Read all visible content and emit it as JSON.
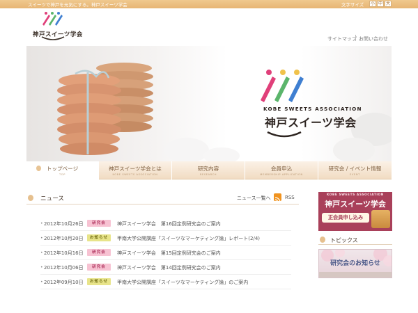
{
  "topbar": {
    "tagline": "スイーツで神戸を元気にする。神戸スイーツ学会",
    "font_size_label": "文字サイズ",
    "font_sizes": [
      "小",
      "中",
      "大"
    ]
  },
  "header": {
    "logo_text": "神戸スイーツ学会",
    "utility_links": [
      "サイトマップ",
      "お問い合わせ"
    ]
  },
  "hero": {
    "title_en": "KOBE SWEETS ASSOCIATION",
    "title_jp": "神戸スイーツ学会"
  },
  "nav": {
    "items": [
      {
        "label": "トップページ",
        "sub": "TOP"
      },
      {
        "label": "神戸スイーツ学会とは",
        "sub": "KOBE SWEETS ASSOCIATION"
      },
      {
        "label": "研究内容",
        "sub": "RESEARCH"
      },
      {
        "label": "会員申込",
        "sub": "MEMBERSHIP APPLICATION"
      },
      {
        "label": "研究会 / イベント情報",
        "sub": "EVENT"
      }
    ]
  },
  "news": {
    "title": "ニュース",
    "more_label": "ニュース一覧へ",
    "rss_label": "RSS",
    "items": [
      {
        "date": "2012年10月26日",
        "badge": "研究会",
        "badge_type": "study",
        "text": "神戸スイーツ学会　第16回定例研究会のご案内"
      },
      {
        "date": "2012年10月20日",
        "badge": "お知らせ",
        "badge_type": "notice",
        "text": "甲南大学公開講座「スイーツなマーケティング論」レポート(2/4)"
      },
      {
        "date": "2012年10月16日",
        "badge": "研究会",
        "badge_type": "study",
        "text": "神戸スイーツ学会　第15回定例研究会のご案内"
      },
      {
        "date": "2012年10月06日",
        "badge": "研究会",
        "badge_type": "study",
        "text": "神戸スイーツ学会　第14回定例研究会のご案内"
      },
      {
        "date": "2012年09月10日",
        "badge": "お知らせ",
        "badge_type": "notice",
        "text": "甲南大学公開講座「スイーツなマーケティング論」のご案内"
      }
    ]
  },
  "sidebar": {
    "banner": {
      "title_en": "KOBE SWEETS ASSOCIATION",
      "title_jp": "神戸スイーツ学会",
      "button": "正会員申し込み"
    },
    "topics": {
      "title": "トピックス",
      "banner_text": "研究会のお知らせ"
    }
  },
  "colors": {
    "accent": "#e7b574",
    "pink": "#e0407a",
    "green": "#5bb56b",
    "blue": "#3f7fd1",
    "badge_study": "#f7c2d2",
    "badge_notice": "#e8e48a"
  }
}
